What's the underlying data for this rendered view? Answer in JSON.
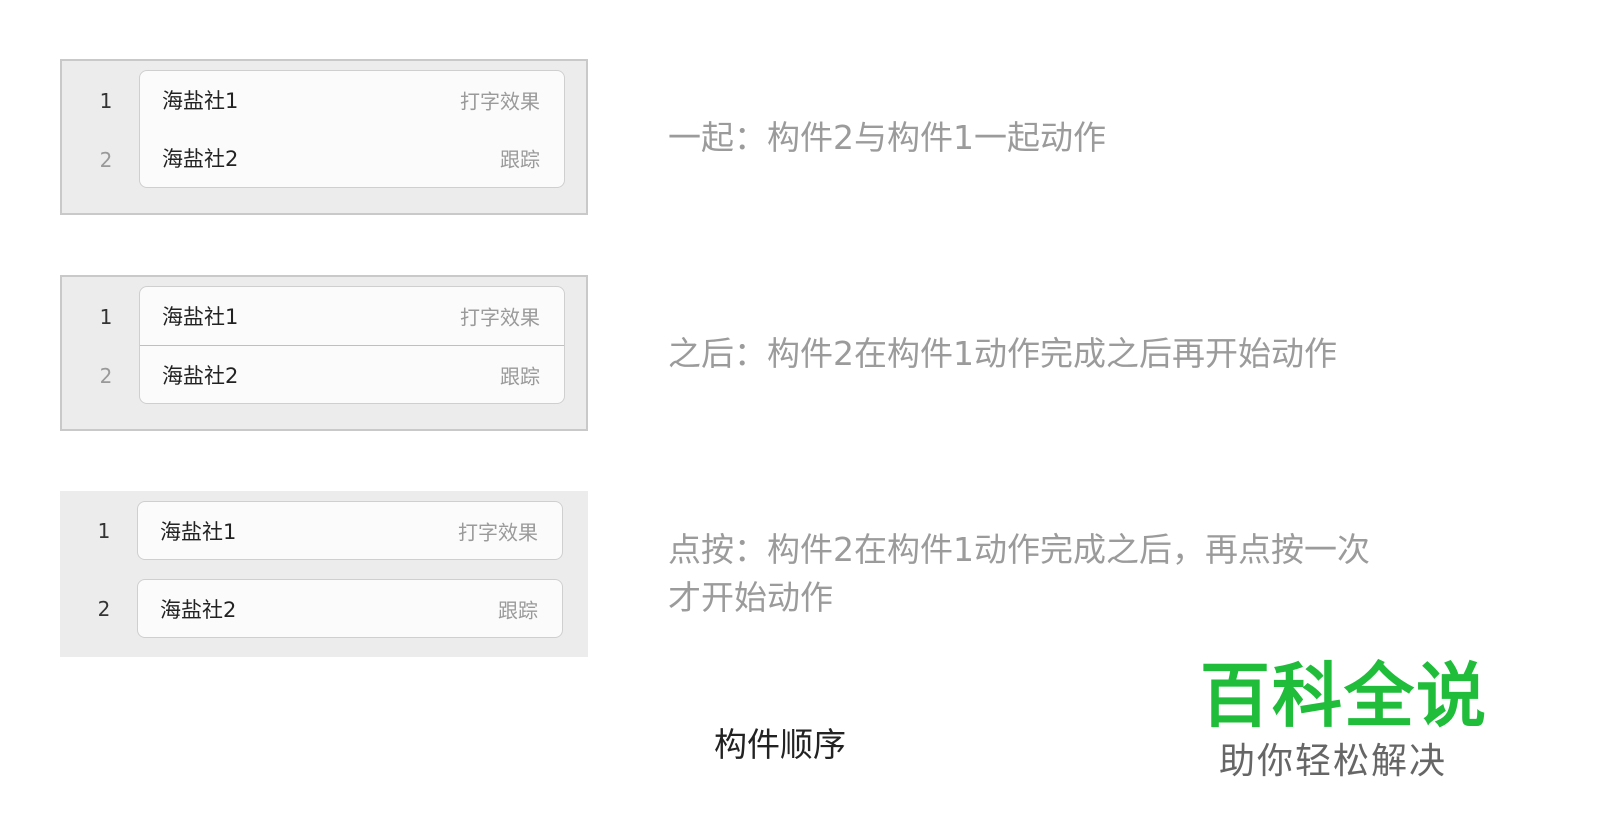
{
  "panels": [
    {
      "rows": [
        {
          "num": "1",
          "name": "海盐社1",
          "effect": "打字效果"
        },
        {
          "num": "2",
          "name": "海盐社2",
          "effect": "跟踪"
        }
      ],
      "description": "一起：构件2与构件1一起动作"
    },
    {
      "rows": [
        {
          "num": "1",
          "name": "海盐社1",
          "effect": "打字效果"
        },
        {
          "num": "2",
          "name": "海盐社2",
          "effect": "跟踪"
        }
      ],
      "description": "之后：构件2在构件1动作完成之后再开始动作"
    },
    {
      "rows": [
        {
          "num": "1",
          "name": "海盐社1",
          "effect": "打字效果"
        },
        {
          "num": "2",
          "name": "海盐社2",
          "effect": "跟踪"
        }
      ],
      "description_line1": "点按：构件2在构件1动作完成之后，再点按一次",
      "description_line2": "才开始动作"
    }
  ],
  "caption": "构件顺序",
  "watermark": {
    "main": "百科全说",
    "sub": "助你轻松解决",
    "color": "#1fbd3a"
  }
}
